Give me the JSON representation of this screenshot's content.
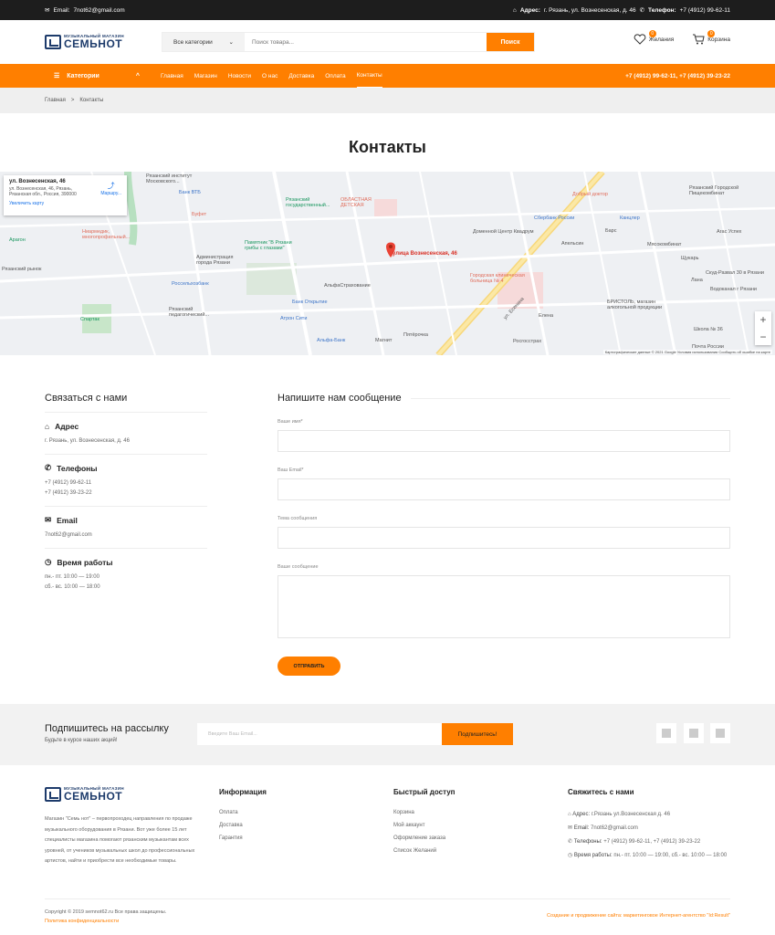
{
  "topbar": {
    "email_label": "Email:",
    "email": "7not62@gmail.com",
    "address_label": "Адрес:",
    "address": "г. Рязань, ул. Вознесенская, д. 46",
    "phone_label": "Телефон:",
    "phone": "+7 (4912) 99-62-11"
  },
  "logo": {
    "small": "МУЗЫКАЛЬНЫЙ МАГАЗИН",
    "big": "СЕМЬНОТ"
  },
  "search": {
    "category": "Все категории",
    "placeholder": "Поиск товара...",
    "button": "Поиск"
  },
  "header_icons": {
    "wishlist_label": "Желания",
    "wishlist_count": "0",
    "cart_label": "Корзина",
    "cart_count": "0"
  },
  "nav": {
    "categories": "Категории",
    "links": [
      "Главная",
      "Магазин",
      "Новости",
      "О нас",
      "Доставка",
      "Оплата",
      "Контакты"
    ],
    "phones": "+7 (4912) 99-62-11, +7 (4912) 39-23-22"
  },
  "breadcrumbs": {
    "home": "Главная",
    "separator": ">",
    "current": "Контакты"
  },
  "page_title": "Контакты",
  "map": {
    "card_title": "ул. Вознесенская, 46",
    "card_address": "ул. Вознесенская, 46, Рязань, Рязанская обл., Россия, 390000",
    "card_route": "Маршру...",
    "card_link": "Увеличить карту",
    "pin_label": "улица Вознесенская, 46",
    "zoom_in": "+",
    "zoom_out": "−",
    "footer": "Картографические данные © 2021 Google   Условия использования   Сообщить об ошибке на карте",
    "labels": [
      {
        "text": "Рязанский институт Московского...",
        "cls": ""
      },
      {
        "text": "Банк ВТБ",
        "cls": "b"
      },
      {
        "text": "Рязанский государственный...",
        "cls": "g"
      },
      {
        "text": "ОБЛАСТНАЯ ДЕТСКАЯ",
        "cls": "r"
      },
      {
        "text": "Добрый доктор",
        "cls": "r"
      },
      {
        "text": "Рязанский Городской Пищекомбинат",
        "cls": ""
      },
      {
        "text": "Буфет",
        "cls": "r"
      },
      {
        "text": "Сбербанк России",
        "cls": "b"
      },
      {
        "text": "Канцлер",
        "cls": "b"
      },
      {
        "text": "Арагон",
        "cls": "g"
      },
      {
        "text": "Ниармедик, многопрофильный...",
        "cls": "r"
      },
      {
        "text": "Памятник \"В Рязани грибы с глазами\"",
        "cls": "g"
      },
      {
        "text": "Доменной Центр Квадрум",
        "cls": ""
      },
      {
        "text": "Барс",
        "cls": ""
      },
      {
        "text": "Мясокомбинат",
        "cls": ""
      },
      {
        "text": "Агас Успех",
        "cls": ""
      },
      {
        "text": "Администрация города Рязани",
        "cls": ""
      },
      {
        "text": "Апельсин",
        "cls": ""
      },
      {
        "text": "Щукарь",
        "cls": ""
      },
      {
        "text": "Скуд-Развал 30 в Рязани",
        "cls": ""
      },
      {
        "text": "Городская клиническая больница № 4",
        "cls": "r"
      },
      {
        "text": "Лана",
        "cls": ""
      },
      {
        "text": "Водоканал г Рязани",
        "cls": ""
      },
      {
        "text": "Россельхозбанк",
        "cls": "b"
      },
      {
        "text": "АльфаСтрахование",
        "cls": ""
      },
      {
        "text": "Рязанский педагогический...",
        "cls": ""
      },
      {
        "text": "Банк Открытие",
        "cls": "b"
      },
      {
        "text": "БРИСТОЛЬ, магазин алкогольной продукции",
        "cls": ""
      },
      {
        "text": "Спартак",
        "cls": "g"
      },
      {
        "text": "Атрон Сити",
        "cls": "b"
      },
      {
        "text": "Елена",
        "cls": ""
      },
      {
        "text": "Школа № 36",
        "cls": ""
      },
      {
        "text": "Альфа-Банк",
        "cls": "b"
      },
      {
        "text": "Магнит",
        "cls": ""
      },
      {
        "text": "Пятёрочка",
        "cls": ""
      },
      {
        "text": "Росгосстрах",
        "cls": ""
      },
      {
        "text": "Почта России",
        "cls": ""
      },
      {
        "text": "Рязанский рынок",
        "cls": ""
      },
      {
        "text": "ул. Есенина",
        "cls": ""
      }
    ]
  },
  "contacts": {
    "heading": "Связаться с нами",
    "address_title": "Адрес",
    "address_value": "г. Рязань, ул. Вознесенская, д. 46",
    "phones_title": "Телефоны",
    "phone1": "+7 (4912) 99-62-11",
    "phone2": "+7 (4912) 39-23-22",
    "email_title": "Email",
    "email_value": "7not62@gmail.com",
    "hours_title": "Время работы",
    "hours1": "пн.- пт. 10:00 — 19:00",
    "hours2": "сб.- вс. 10:00 — 18:00"
  },
  "form": {
    "heading": "Напишите нам сообщение",
    "name_label": "Ваше имя*",
    "email_label": "Ваш Email*",
    "subject_label": "Тема сообщения",
    "message_label": "Ваше сообщение",
    "submit": "ОТПРАВИТЬ"
  },
  "newsletter": {
    "heading": "Подпишитесь на рассылку",
    "subheading": "Будьте в курсе наших акций!",
    "placeholder": "Введите Ваш Email...",
    "button": "Подпишитесь!"
  },
  "footer": {
    "about": "Магазин \"Семь нот\" – первопроходец направления по продаже музыкального оборудования в Рязани. Вот уже более 15 лет специалисты магазина помогают рязанским музыкантам всех уровней, от учеников музыкальных школ до профессиональных артистов, найти и приобрести все необходимые товары.",
    "info_title": "Информация",
    "info_links": [
      "Оплата",
      "Доставка",
      "Гарантия"
    ],
    "quick_title": "Быстрый доступ",
    "quick_links": [
      "Корзина",
      "Мой аккаунт",
      "Оформление заказа",
      "Список Желаний"
    ],
    "contact_title": "Свяжитесь с нами",
    "contact_address_label": "Адрес:",
    "contact_address": "г.Рязань ул.Вознесенская д. 46",
    "contact_email_label": "Email:",
    "contact_email": "7not62@gmail.com",
    "contact_phones_label": "Телефоны:",
    "contact_phones": "+7 (4912) 99-62-11, +7 (4912) 39-23-22",
    "contact_hours_label": "Время работы:",
    "contact_hours": "пн.- пт. 10:00 — 19:00, сб.- вс. 10:00 — 18:00",
    "copyright": "Copyright © 2019 semnot62.ru Все права защищены.",
    "privacy": "Политика конфиденциальности",
    "developer": "Создание и продвижение сайта: маркетинговое Интернет-агентство \"Id:Result\""
  },
  "colors": {
    "accent": "#ff7f00",
    "dark": "#1d1d1d",
    "brand": "#1d3b6b"
  }
}
